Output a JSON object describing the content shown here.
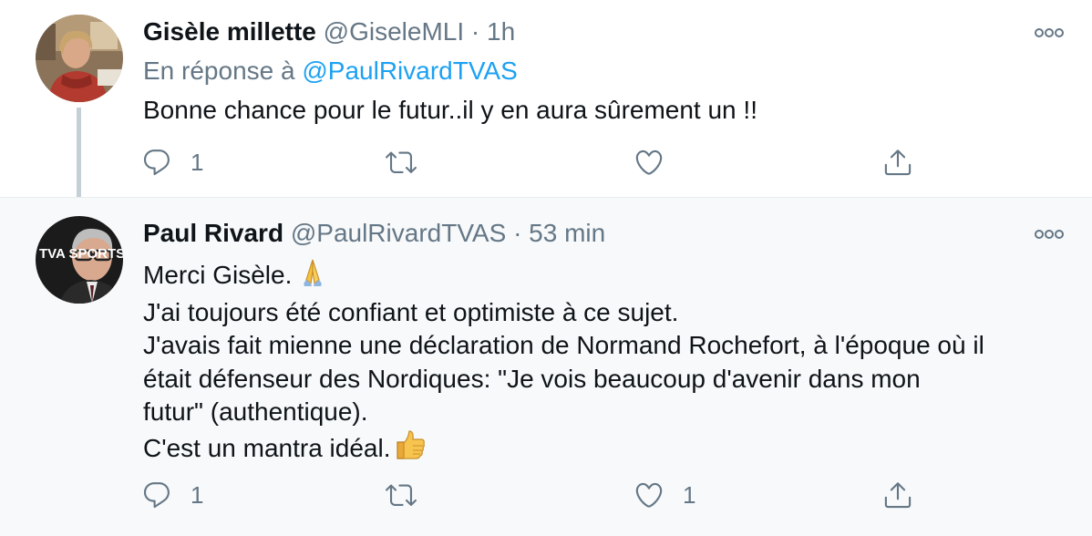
{
  "tweets": [
    {
      "author_name": "Gisèle millette",
      "handle": "@GiseleMLI",
      "separator": "·",
      "time": "1h",
      "reply_prefix": "En réponse à",
      "reply_mention": "@PaulRivardTVAS",
      "text": "Bonne chance pour le futur..il y en aura sûrement un !!",
      "reply_count": "1",
      "retweet_count": "",
      "like_count": "",
      "avatar_icon": "profile-photo"
    },
    {
      "author_name": "Paul Rivard",
      "handle": "@PaulRivardTVAS",
      "separator": "·",
      "time": "53 min",
      "lines": [
        "Merci Gisèle.",
        "J'ai toujours été confiant et optimiste à ce sujet.",
        "J'avais fait mienne une déclaration de Normand Rochefort, à l'époque où il",
        "était défenseur des Nordiques: \"Je vois beaucoup d'avenir dans mon",
        "futur\" (authentique).",
        "C'est un mantra idéal."
      ],
      "emojis": [
        "folded-hands-emoji",
        "thumbs-up-emoji"
      ],
      "reply_count": "1",
      "retweet_count": "",
      "like_count": "1",
      "avatar_icon": "profile-photo",
      "avatar_badge": "TVA SPORTS"
    }
  ],
  "colors": {
    "accent": "#1da1f2",
    "secondary_text": "#657786",
    "thread_line": "#c4cfd6",
    "highlight_bg": "#f7f9fa"
  }
}
